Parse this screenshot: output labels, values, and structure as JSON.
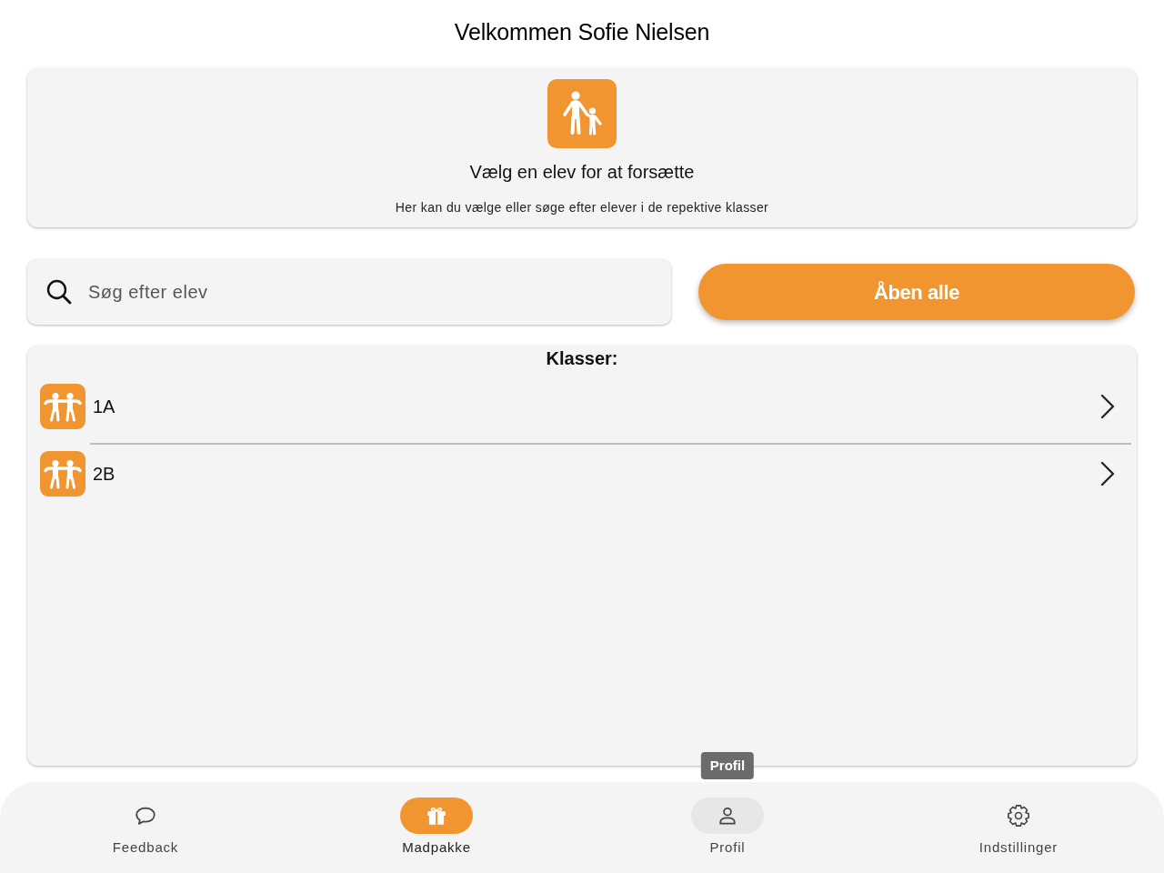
{
  "header": {
    "title": "Velkommen Sofie Nielsen"
  },
  "intro_card": {
    "title": "Vælg en elev for at forsætte",
    "subtitle": "Her kan du vælge eller søge efter elever i de repektive klasser"
  },
  "search": {
    "placeholder": "Søg efter elev"
  },
  "open_all_button": {
    "label": "Åben alle"
  },
  "classes": {
    "title": "Klasser:",
    "items": [
      {
        "label": "1A"
      },
      {
        "label": "2B"
      }
    ]
  },
  "bottom_nav": {
    "items": [
      {
        "kind": "feedback",
        "label": "Feedback",
        "selected": false,
        "hovered": false
      },
      {
        "kind": "lunchbox",
        "label": "Madpakke",
        "selected": true,
        "hovered": false
      },
      {
        "kind": "profile",
        "label": "Profil",
        "selected": false,
        "hovered": true,
        "tooltip": "Profil"
      },
      {
        "kind": "settings",
        "label": "Indstillinger",
        "selected": false,
        "hovered": false
      }
    ]
  }
}
